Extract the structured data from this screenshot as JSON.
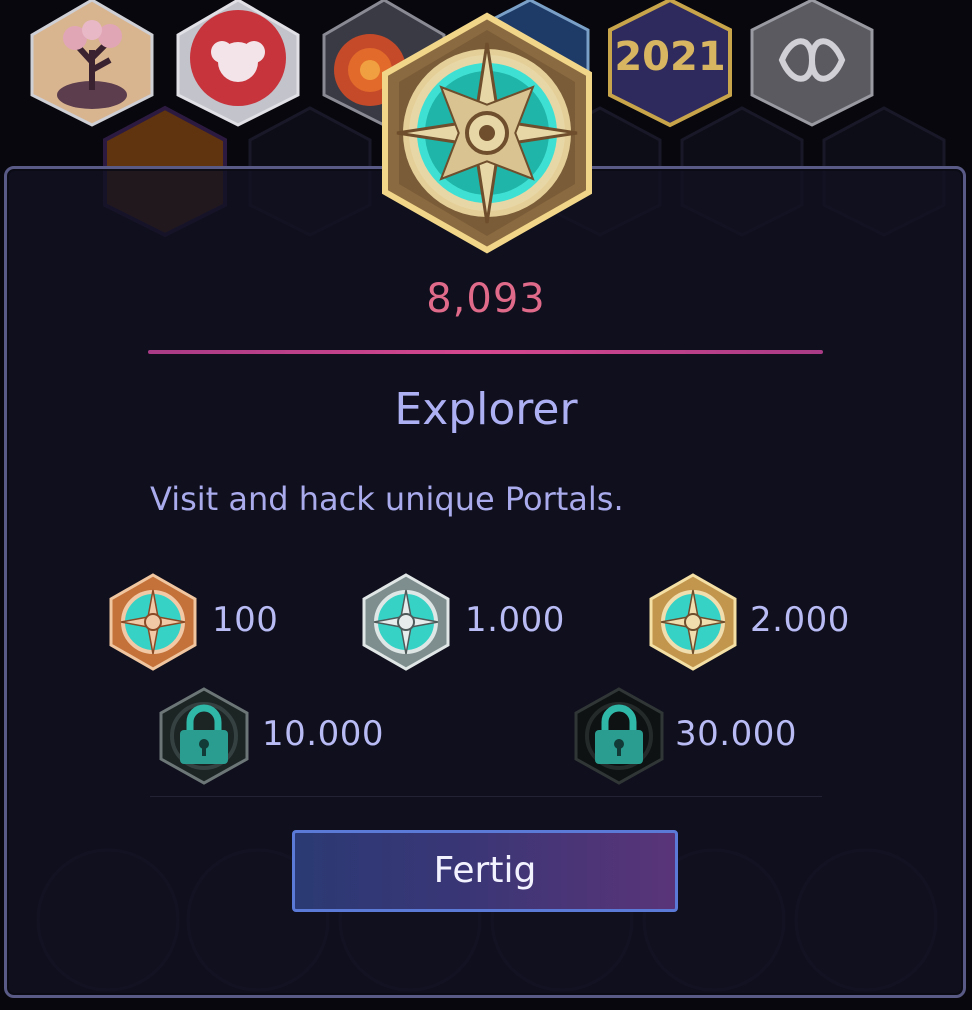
{
  "badge": {
    "name": "Explorer",
    "count": "8,093",
    "description": "Visit and hack unique Portals.",
    "current_tier": "gold",
    "accent_color": "#e06a8a"
  },
  "background_badges": {
    "year_badge_text": "2021"
  },
  "tiers": [
    {
      "tier": "bronze",
      "value": "100",
      "state": "unlocked",
      "icon": "compass-bronze-icon"
    },
    {
      "tier": "silver",
      "value": "1.000",
      "state": "unlocked",
      "icon": "compass-silver-icon"
    },
    {
      "tier": "gold",
      "value": "2.000",
      "state": "unlocked",
      "icon": "compass-gold-icon"
    },
    {
      "tier": "platinum",
      "value": "10.000",
      "state": "locked",
      "icon": "padlock-icon"
    },
    {
      "tier": "onyx",
      "value": "30.000",
      "state": "locked",
      "icon": "padlock-icon"
    }
  ],
  "actions": {
    "done_label": "Fertig"
  }
}
